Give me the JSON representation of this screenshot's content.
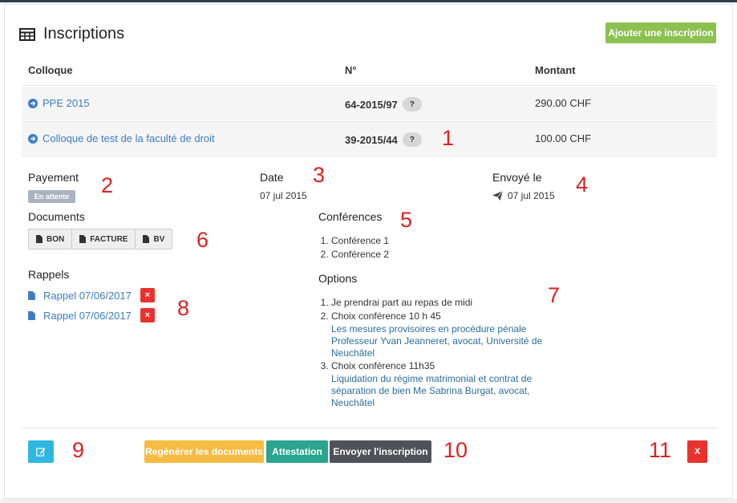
{
  "page": {
    "title": "Inscriptions",
    "add_button": "Ajouter une inscription"
  },
  "table": {
    "headers": [
      "Colloque",
      "N°",
      "Montant"
    ],
    "rows": [
      {
        "colloque": "PPE 2015",
        "numero": "64-2015/97",
        "badge": "?",
        "montant": "290.00 CHF"
      },
      {
        "colloque": "Colloque de test de la faculté de droit",
        "numero": "39-2015/44",
        "badge": "?",
        "montant": "100.00 CHF"
      }
    ]
  },
  "details": {
    "payement_label": "Payement",
    "payement_status": "En attente",
    "date_label": "Date",
    "date_value": "07 jul 2015",
    "envoye_label": "Envoyé le",
    "envoye_value": "07 jul 2015",
    "documents_label": "Documents",
    "documents": [
      "BON",
      "FACTURE",
      "BV"
    ],
    "rappels_label": "Rappels",
    "rappels": [
      "Rappel 07/06/2017",
      "Rappel 07/06/2017"
    ],
    "rappel_delete": "×",
    "conferences_label": "Conférences",
    "conferences": [
      "Conférence 1",
      "Conférence 2"
    ],
    "options_label": "Options",
    "options": [
      {
        "text": "Je prendrai part au repas de midi",
        "detail": ""
      },
      {
        "text": "Choix conférence 10 h 45",
        "detail": "Les mesures provisoires en procédure pénale Professeur Yvan Jeanneret, avocat, Université de Neuchâtel"
      },
      {
        "text": "Choix conférence 11h35",
        "detail": "Liquidation du régime matrimonial et contrat de séparation de bien Me Sabrina Burgat, avocat, Neuchâtel"
      }
    ]
  },
  "actions": {
    "regen": "Regénérer les documents",
    "attestation": "Attestation",
    "send": "Envoyer l'inscription",
    "delete": "X"
  },
  "annotations": [
    "1",
    "2",
    "3",
    "4",
    "5",
    "6",
    "7",
    "8",
    "9",
    "10",
    "11"
  ],
  "colors": {
    "add": "#8cc152",
    "link": "#3b7dc3",
    "regen": "#f6bb42",
    "attestation": "#2aa58f",
    "send": "#4f5258",
    "danger": "#e9322d",
    "edit": "#2fb7e2"
  }
}
